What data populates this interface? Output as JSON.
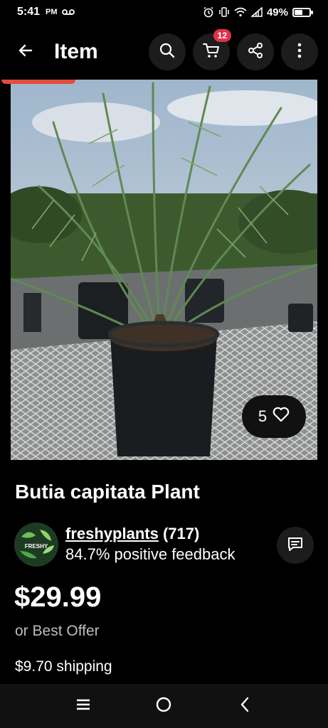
{
  "status_bar": {
    "time": "5:41",
    "ampm": "PM",
    "battery_percent": "49%",
    "battery_level": 0.49,
    "icons": [
      "voicemail-icon",
      "alarm-icon",
      "vibrate-icon",
      "wifi-icon",
      "signal-icon",
      "battery-icon"
    ]
  },
  "app_bar": {
    "title": "Item",
    "cart_count": "12",
    "icons": [
      "back-arrow-icon",
      "search-icon",
      "cart-icon",
      "share-icon",
      "more-vert-icon"
    ]
  },
  "listing": {
    "watch_count": "5",
    "title": "Butia capitata Plant",
    "seller": {
      "name": "freshyplants",
      "rating_count": "(717)",
      "feedback": "84.7% positive feedback",
      "avatar_text": "FRESHY"
    },
    "price": "$29.99",
    "best_offer": "or Best Offer",
    "shipping": "$9.70 shipping"
  },
  "nav": {
    "icons": [
      "recents-icon",
      "home-icon",
      "back-icon"
    ]
  },
  "colors": {
    "background": "#000000",
    "badge": "#e0324a",
    "button_bg": "#1c1c1c",
    "secondary_text": "#bcbcbc"
  }
}
